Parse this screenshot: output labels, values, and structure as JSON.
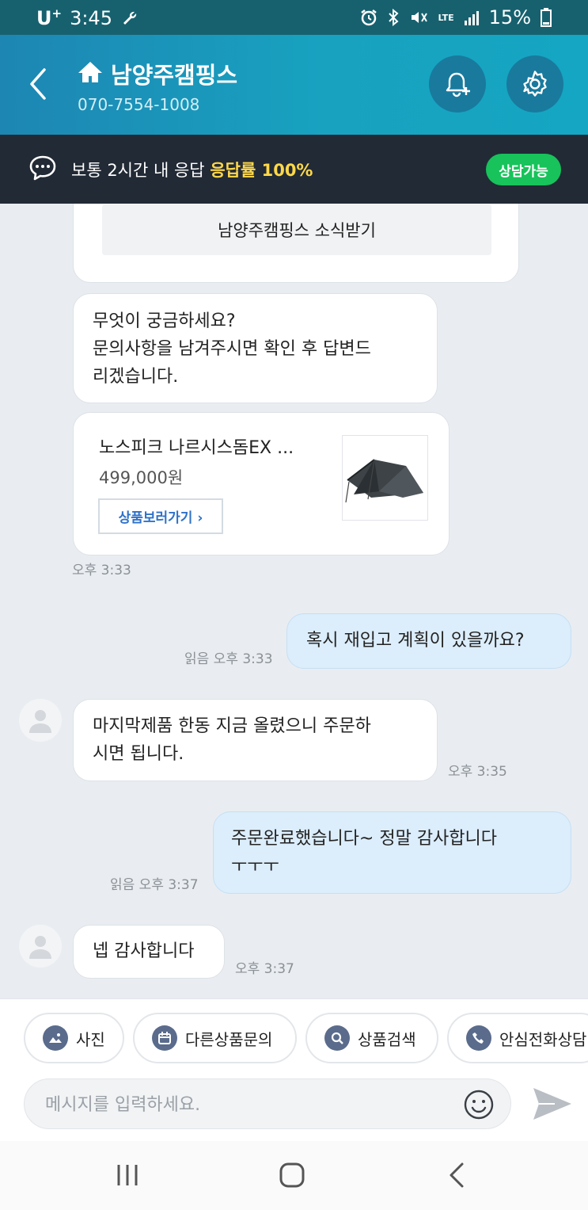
{
  "status_bar": {
    "carrier": "U",
    "carrier_sup": "+",
    "time": "3:45",
    "battery": "15%",
    "network": "LTE"
  },
  "header": {
    "title": "남양주캠핑스",
    "phone": "070-7554-1008"
  },
  "info_bar": {
    "response_text": "보통 2시간 내 응답",
    "rate_text": "응답률 100%",
    "status_badge": "상담가능"
  },
  "chat": {
    "subscribe_label": "남양주캠핑스 소식받기",
    "welcome_message": "무엇이 궁금하세요?\n문의사항을 남겨주시면 확인 후 답변드\n리겠습니다.",
    "product": {
      "name": "노스피크 나르시스돔EX ...",
      "price": "499,000원",
      "link_label": "상품보러가기 ›"
    },
    "product_time": "오후 3:33",
    "messages": [
      {
        "sender": "me",
        "text": "혹시 재입고 계획이 있을까요?",
        "meta": "읽음 오후 3:33"
      },
      {
        "sender": "seller",
        "text": "마지막제품 한동 지금 올렸으니 주문하\n시면 됩니다.",
        "meta": "오후 3:35"
      },
      {
        "sender": "me",
        "text": "주문완료했습니다~ 정말 감사합니다\nㅜㅜㅜ",
        "meta": "읽음 오후 3:37"
      },
      {
        "sender": "seller",
        "text": "넵 감사합니다",
        "meta": "오후 3:37"
      }
    ]
  },
  "actions": {
    "chips": [
      {
        "label": "사진",
        "icon": "photo-icon"
      },
      {
        "label": "다른상품문의",
        "icon": "calendar-icon"
      },
      {
        "label": "상품검색",
        "icon": "search-icon"
      },
      {
        "label": "안심전화상담",
        "icon": "phone-icon"
      }
    ]
  },
  "composer": {
    "placeholder": "메시지를 입력하세요.",
    "value": ""
  },
  "colors": {
    "header_start": "#1d86b3",
    "header_end": "#14a6c2",
    "info_bar_bg": "#222a36",
    "rate_highlight": "#ffd84a",
    "status_badge": "#17c35a",
    "my_bubble": "#dcedfb",
    "link_blue": "#2f72c8"
  }
}
